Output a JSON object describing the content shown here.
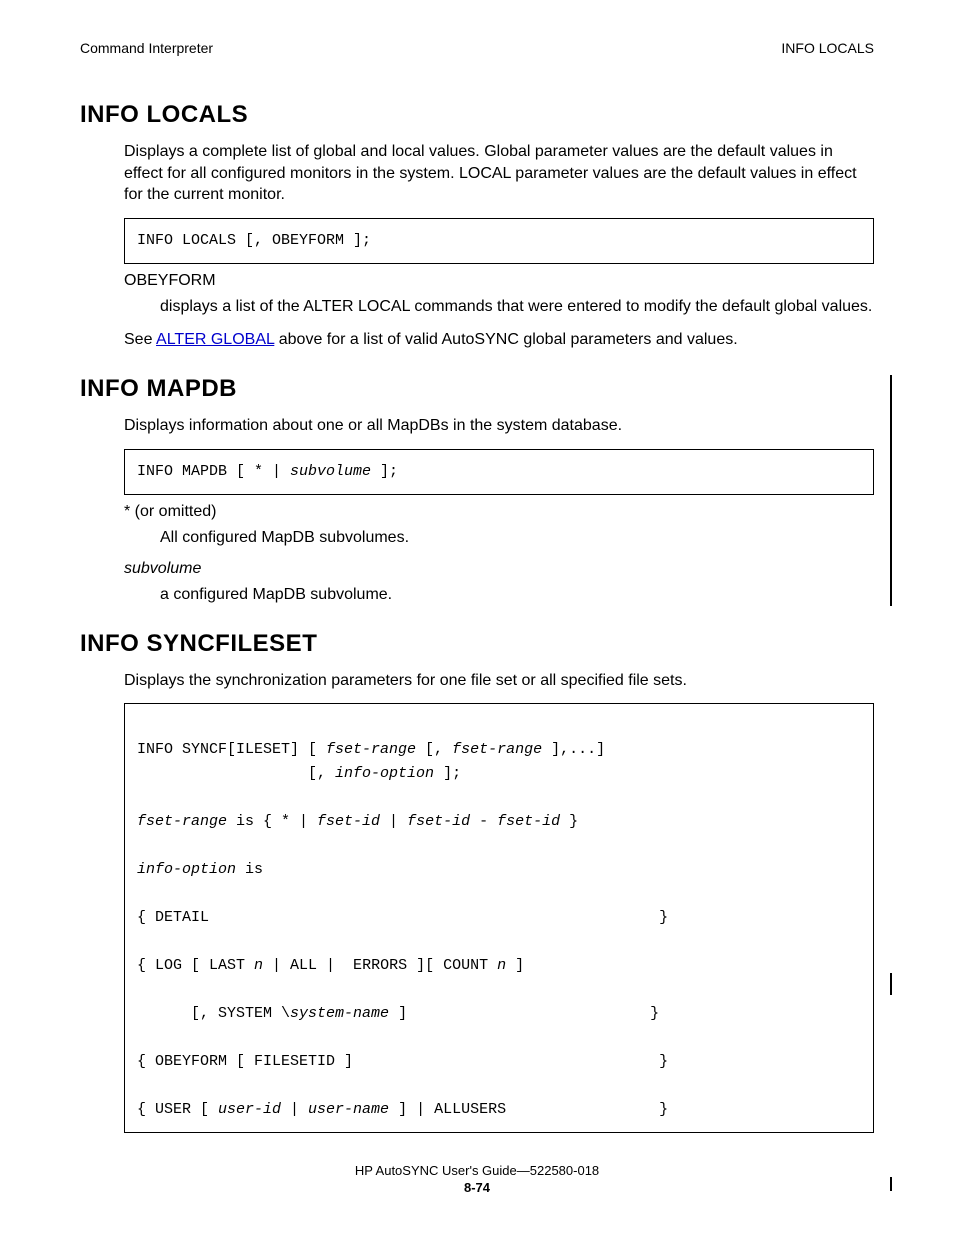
{
  "header": {
    "left": "Command Interpreter",
    "right": "INFO LOCALS"
  },
  "sections": {
    "info_locals": {
      "title": "INFO LOCALS",
      "desc": "Displays a complete list of global and local values. Global parameter values are the default values in effect for all configured monitors in the system. LOCAL parameter values are the default values in effect for the current monitor.",
      "syntax": "INFO LOCALS [, OBEYFORM ];",
      "param_name": "OBEYFORM",
      "param_desc": "displays a list of the ALTER LOCAL commands that were entered to modify the default global values.",
      "see_prefix": "See ",
      "see_link": "ALTER GLOBAL",
      "see_suffix": " above for a list of valid AutoSYNC global parameters and values."
    },
    "info_mapdb": {
      "title": "INFO MAPDB",
      "desc": "Displays information about one or all MapDBs in the system database.",
      "syntax_a": "INFO MAPDB [ * | ",
      "syntax_b": "subvolume",
      "syntax_c": " ];",
      "p1_name": "* (or omitted)",
      "p1_desc": "All configured MapDB subvolumes.",
      "p2_name": "subvolume",
      "p2_desc": "a configured MapDB subvolume."
    },
    "info_sync": {
      "title": "INFO SYNCFILESET",
      "desc": "Displays the synchronization parameters for one file set or all specified file sets.",
      "l1a": "INFO SYNCF[ILESET] [ ",
      "l1b": "fset-range",
      "l1c": " [, ",
      "l1d": "fset-range",
      "l1e": " ],...]",
      "l2a": "                   [, ",
      "l2b": "info-option",
      "l2c": " ];",
      "l3a": "fset-range",
      "l3b": " is { * | ",
      "l3c": "fset-id",
      "l3d": " | ",
      "l3e": "fset-id",
      "l3f": " - ",
      "l3g": "fset-id",
      "l3h": " }",
      "l4a": "info-option",
      "l4b": " is",
      "l5": "{ DETAIL                                                  }",
      "l6a": "{ LOG [ LAST ",
      "l6b": "n",
      "l6c": " | ALL |  ERRORS ][ COUNT ",
      "l6d": "n",
      "l6e": " ]",
      "l7a": "      [, SYSTEM \\",
      "l7b": "system-name",
      "l7c": " ]                           }",
      "l8": "{ OBEYFORM [ FILESETID ]                                  }",
      "l9a": "{ USER [ ",
      "l9b": "user-id",
      "l9c": " | ",
      "l9d": "user-name",
      "l9e": " ] | ALLUSERS                 }"
    }
  },
  "footer": {
    "line1": "HP AutoSYNC User's Guide—522580-018",
    "line2": "8-74"
  }
}
